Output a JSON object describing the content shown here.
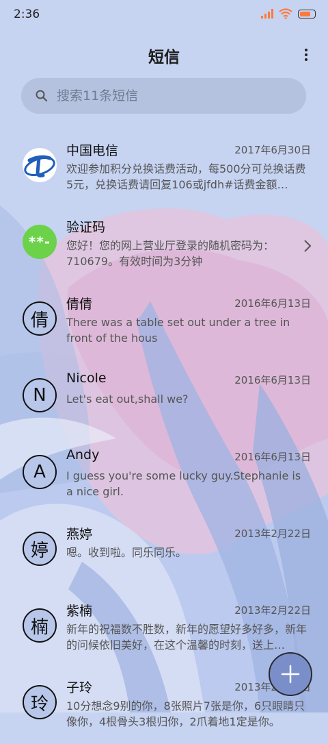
{
  "status_bar": {
    "time": "2:36",
    "battery_level": 0.85
  },
  "header": {
    "title": "短信",
    "menu_icon": "more-vertical-icon"
  },
  "search": {
    "placeholder": "搜索11条短信"
  },
  "colors": {
    "background": "#c6d3f1",
    "accent_green": "#6cd24a",
    "fab": "#7a8fca"
  },
  "conversations": [
    {
      "name": "中国电信",
      "date": "2017年6月30日",
      "preview": "欢迎参加积分兑换话费活动，每500分可兑换话费5元，兑换话费请回复106或jfdh#话费金额…",
      "avatar": "china-telecom-logo-icon"
    },
    {
      "name": "验证码",
      "date": "",
      "preview": "您好！您的网上营业厅登录的随机密码为：710679。有效时间为3分钟",
      "avatar_text": "**-"
    },
    {
      "name": "倩倩",
      "date": "2016年6月13日",
      "preview": "There was a table set out under a tree in front of the hous",
      "avatar_text": "倩"
    },
    {
      "name": "Nicole",
      "date": "2016年6月13日",
      "preview": "Let's eat out,shall we?",
      "avatar_text": "N"
    },
    {
      "name": "Andy",
      "date": "2016年6月13日",
      "preview": "I guess you're some lucky guy.Stephanie is a nice girl.",
      "avatar_text": "A"
    },
    {
      "name": "燕婷",
      "date": "2013年2月22日",
      "preview": "嗯。收到啦。同乐同乐。",
      "avatar_text": "婷"
    },
    {
      "name": "紫楠",
      "date": "2013年2月22日",
      "preview": "新年的祝福数不胜数，新年的愿望好多好多，新年的问候依旧美好，在这个温馨的时刻，送上…",
      "avatar_text": "楠"
    },
    {
      "name": "子玲",
      "date": "2013年2月22日",
      "preview": "10分想念9别的你，8张照片7张是你，6只眼睛只像你，4根骨头3根归你，2爪着地1定是你。",
      "avatar_text": "玲"
    }
  ],
  "fab": {
    "icon": "plus-icon"
  }
}
